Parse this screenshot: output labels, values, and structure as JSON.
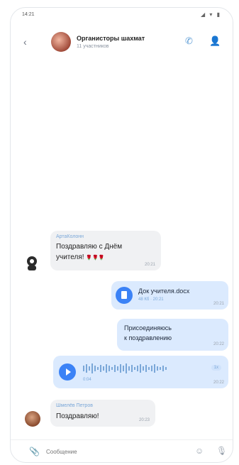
{
  "status": {
    "time": "14:21",
    "icons": "◢ ▾ ▮"
  },
  "header": {
    "title": "Органисторы шахмат",
    "subtitle": "11 участников"
  },
  "messages": {
    "m1": {
      "author": "АртаКолонн",
      "text_line1": "Поздравляю с Днём",
      "text_line2": "учителя!",
      "emoji": "🌹🌹🌹",
      "time": "20:21"
    },
    "m2": {
      "file_name": "Док учителя.docx",
      "file_meta": "48 Кб · 20:21",
      "time": "20:21"
    },
    "m3": {
      "line1": "Присоединяюсь",
      "line2": "к поздравлению",
      "time": "20:22"
    },
    "m4": {
      "duration": "0:04",
      "speed": "1x",
      "time": "20:22"
    },
    "m5": {
      "author": "Шмелёв Петров",
      "text": "Поздравляю!",
      "time": "20:23"
    }
  },
  "input": {
    "placeholder": "Сообщение"
  },
  "icons": {
    "back": "back-arrow-icon",
    "call": "phone-icon",
    "add_user": "add-user-icon",
    "file": "document-icon",
    "play": "play-icon",
    "clip": "paperclip-icon",
    "sticker": "sticker-icon",
    "mic": "microphone-icon"
  },
  "colors": {
    "accent": "#3b82f6",
    "outgoing_bubble": "#dbeafe",
    "incoming_bubble": "#f0f1f3"
  }
}
